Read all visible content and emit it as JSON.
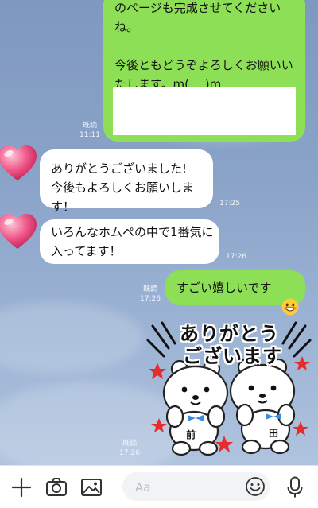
{
  "messages": [
    {
      "side": "me",
      "text": "のページも完成させてくださいね。\n\n今後ともどうぞよろしくお願いいたします。m(_ _)m",
      "read": "既読",
      "time": "11:11"
    },
    {
      "side": "them",
      "text": "ありがとうございました!\n今後もよろしくお願いします！",
      "time": "17:25"
    },
    {
      "side": "them",
      "text": "いろんなホムペの中で1番気に入ってます！",
      "time": "17:26"
    },
    {
      "side": "me",
      "text": "すごい嬉しいです",
      "read": "既読",
      "time": "17:26"
    },
    {
      "side": "me",
      "type": "sticker",
      "sticker_text": [
        "ありがとう",
        "ございます"
      ],
      "badges": [
        "前",
        "田"
      ],
      "read": "既読",
      "time": "17:26"
    }
  ],
  "composer": {
    "placeholder": "Aa"
  },
  "colors": {
    "my_bubble": "#8de055",
    "their_bubble": "#ffffff",
    "background": "#8aa3c8"
  },
  "icons": [
    "heart-icon",
    "grinning-emoji-icon",
    "plus-icon",
    "camera-icon",
    "image-icon",
    "smiley-icon",
    "microphone-icon"
  ]
}
